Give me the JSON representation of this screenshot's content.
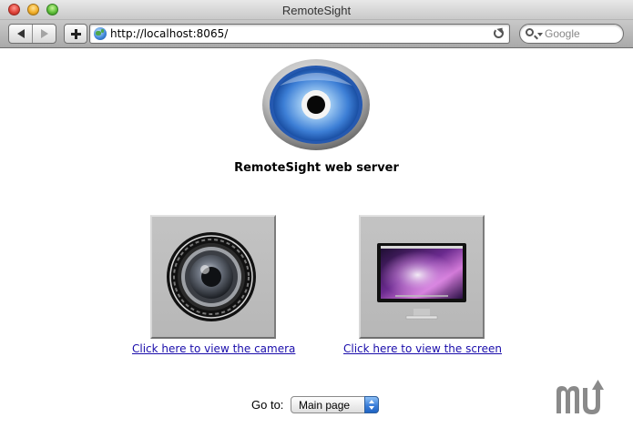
{
  "window": {
    "title": "RemoteSight"
  },
  "toolbar": {
    "url": "http://localhost:8065/",
    "search_placeholder": "Google"
  },
  "page": {
    "server_title": "RemoteSight web server",
    "camera_link": "Click here to view the camera",
    "screen_link": "Click here to view the screen",
    "goto_label": "Go to:",
    "goto_selected": "Main page"
  },
  "icons": {
    "logo": "eye-icon",
    "camera": "camera-lens-icon",
    "screen": "monitor-icon",
    "watermark": "mu-logo-icon"
  },
  "colors": {
    "link": "#1a0dab",
    "eye_blue": "#2f6fd0"
  }
}
